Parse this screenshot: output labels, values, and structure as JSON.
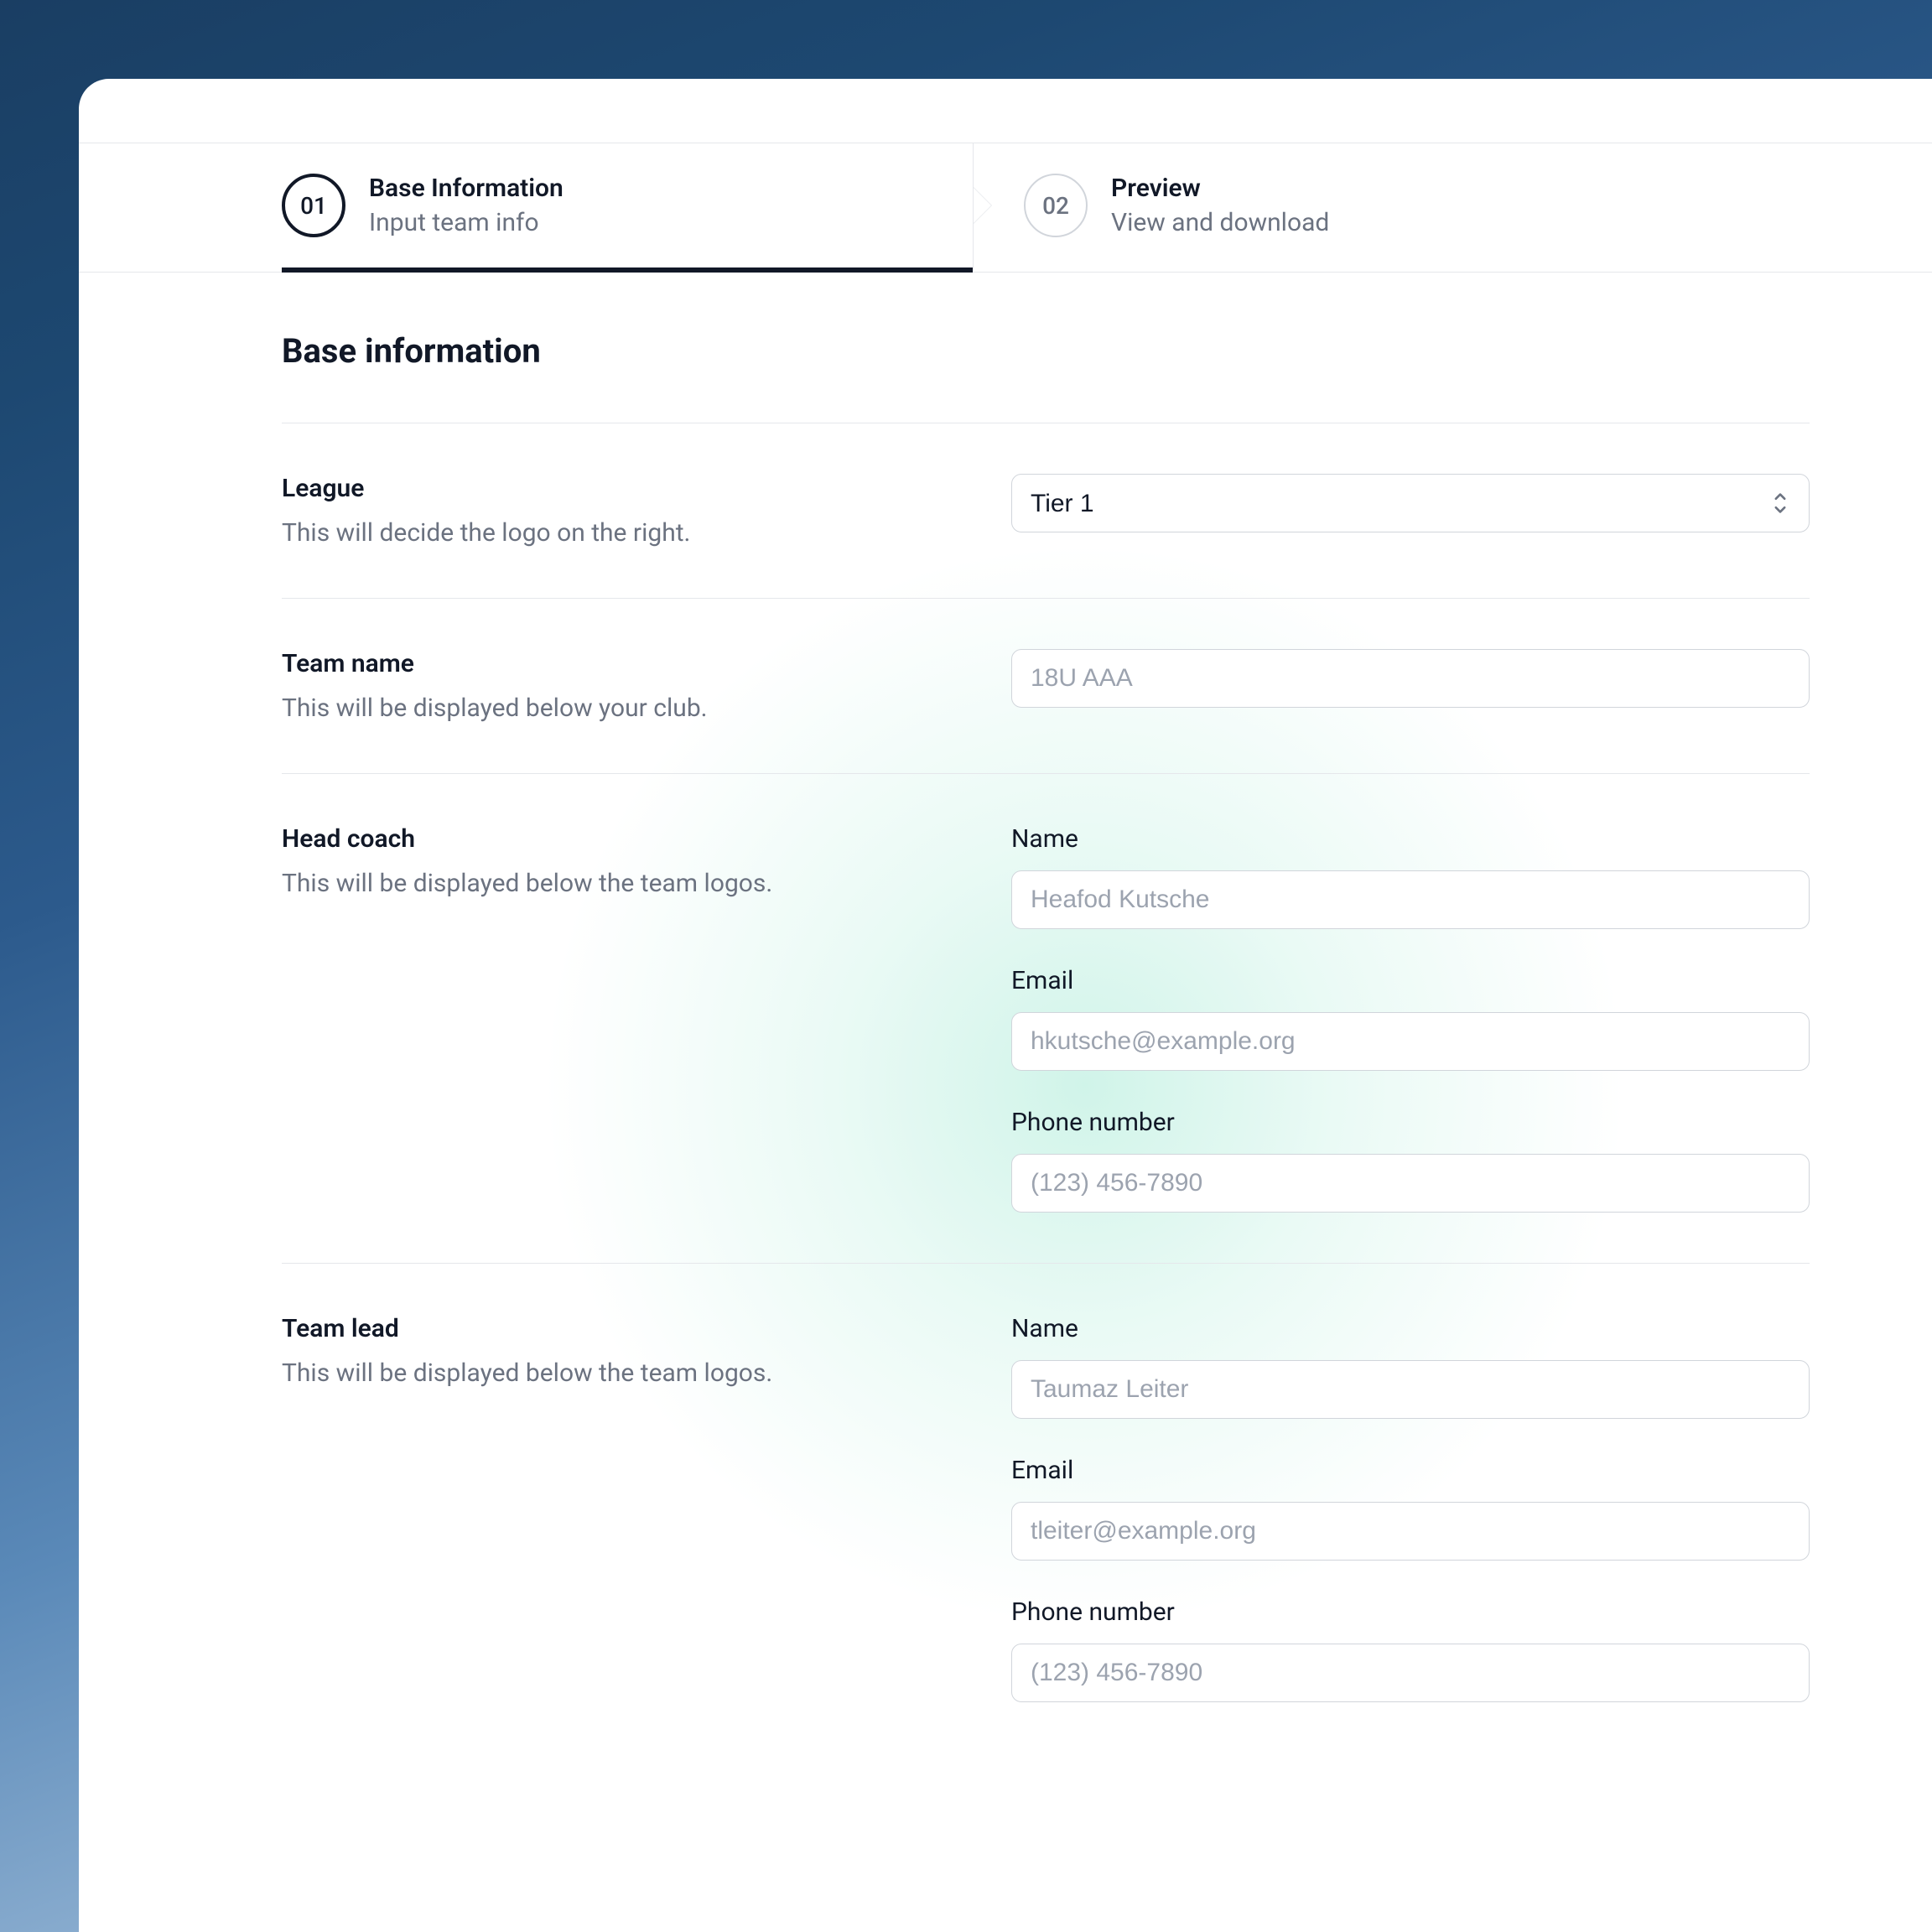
{
  "stepper": {
    "step1": {
      "num": "01",
      "title": "Base Information",
      "sub": "Input team info"
    },
    "step2": {
      "num": "02",
      "title": "Preview",
      "sub": "View and download"
    }
  },
  "page": {
    "heading": "Base information"
  },
  "league": {
    "label": "League",
    "hint": "This will decide the logo on the right.",
    "selected": "Tier 1"
  },
  "team_name": {
    "label": "Team name",
    "hint": "This will be displayed below your club.",
    "placeholder": "18U AAA"
  },
  "head_coach": {
    "label": "Head coach",
    "hint": "This will be displayed below the team logos.",
    "name": {
      "label": "Name",
      "placeholder": "Heafod Kutsche"
    },
    "email": {
      "label": "Email",
      "placeholder": "hkutsche@example.org"
    },
    "phone": {
      "label": "Phone number",
      "placeholder": "(123) 456-7890"
    }
  },
  "team_lead": {
    "label": "Team lead",
    "hint": "This will be displayed below the team logos.",
    "name": {
      "label": "Name",
      "placeholder": "Taumaz Leiter"
    },
    "email": {
      "label": "Email",
      "placeholder": "tleiter@example.org"
    },
    "phone": {
      "label": "Phone number",
      "placeholder": "(123) 456-7890"
    }
  }
}
